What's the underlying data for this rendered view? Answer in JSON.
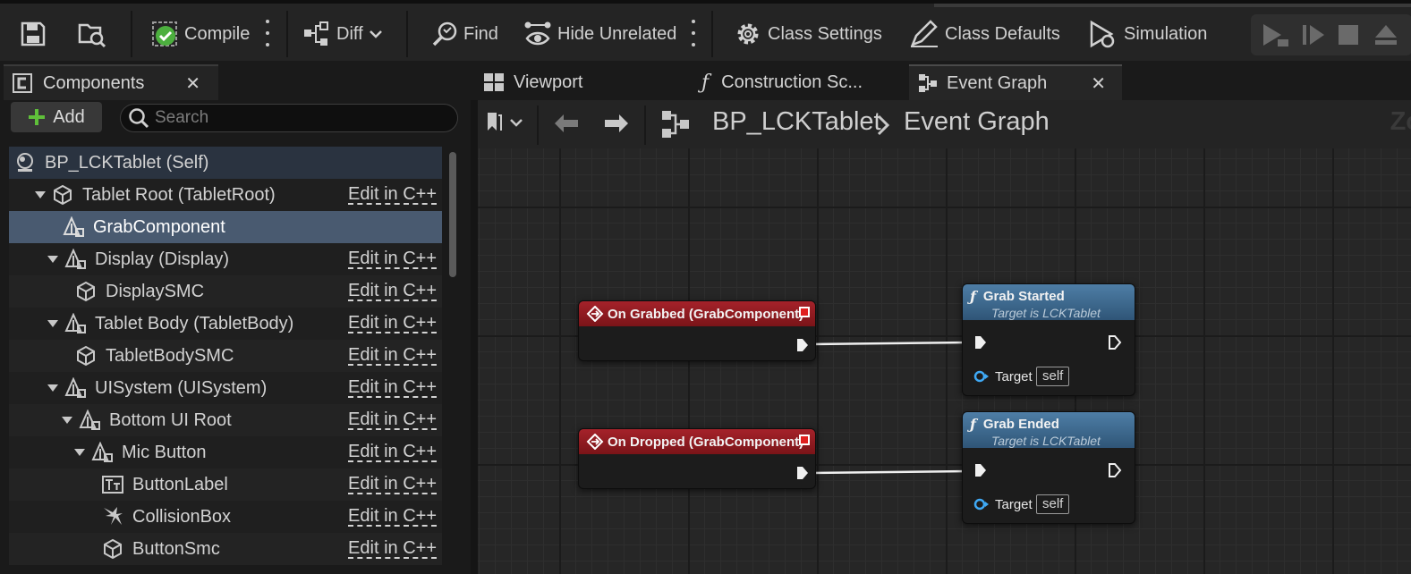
{
  "toolbar": {
    "compile": "Compile",
    "diff": "Diff",
    "find": "Find",
    "hide_unrelated": "Hide Unrelated",
    "class_settings": "Class Settings",
    "class_defaults": "Class Defaults",
    "simulation": "Simulation"
  },
  "components": {
    "tab_title": "Components",
    "add_label": "Add",
    "search_placeholder": "Search",
    "edit_label": "Edit in C++",
    "items": [
      {
        "label": "BP_LCKTablet (Self)",
        "icon": "actor-icon"
      },
      {
        "label": "Tablet Root (TabletRoot)",
        "icon": "mesh-icon"
      },
      {
        "label": "GrabComponent",
        "icon": "scene-component-icon"
      },
      {
        "label": "Display (Display)",
        "icon": "scene-component-icon"
      },
      {
        "label": "DisplaySMC",
        "icon": "mesh-icon"
      },
      {
        "label": "Tablet Body (TabletBody)",
        "icon": "scene-component-icon"
      },
      {
        "label": "TabletBodySMC",
        "icon": "mesh-icon"
      },
      {
        "label": "UISystem (UISystem)",
        "icon": "scene-component-icon"
      },
      {
        "label": "Bottom UI Root",
        "icon": "scene-component-icon"
      },
      {
        "label": "Mic Button",
        "icon": "scene-component-icon"
      },
      {
        "label": "ButtonLabel",
        "icon": "text-render-icon"
      },
      {
        "label": "CollisionBox",
        "icon": "collision-icon"
      },
      {
        "label": "ButtonSmc",
        "icon": "mesh-icon"
      }
    ]
  },
  "graph_tabs": {
    "viewport": "Viewport",
    "construction": "Construction Sc...",
    "event_graph": "Event Graph"
  },
  "breadcrumb": {
    "blueprint": "BP_LCKTablet",
    "graph": "Event Graph",
    "zoom": "Zo"
  },
  "nodes": {
    "on_grabbed": "On Grabbed (GrabComponent)",
    "on_dropped": "On Dropped (GrabComponent)",
    "grab_started": "Grab Started",
    "grab_ended": "Grab Ended",
    "target_is": "Target is LCKTablet",
    "target_label": "Target",
    "target_value": "self"
  },
  "colors": {
    "event_header": "#a5222a",
    "function_header": "#4e7ea6",
    "selected_row": "#495a70",
    "compile_ok": "#4caf3e",
    "add_plus": "#5fbf3a",
    "target_pin": "#3fa9f5"
  }
}
